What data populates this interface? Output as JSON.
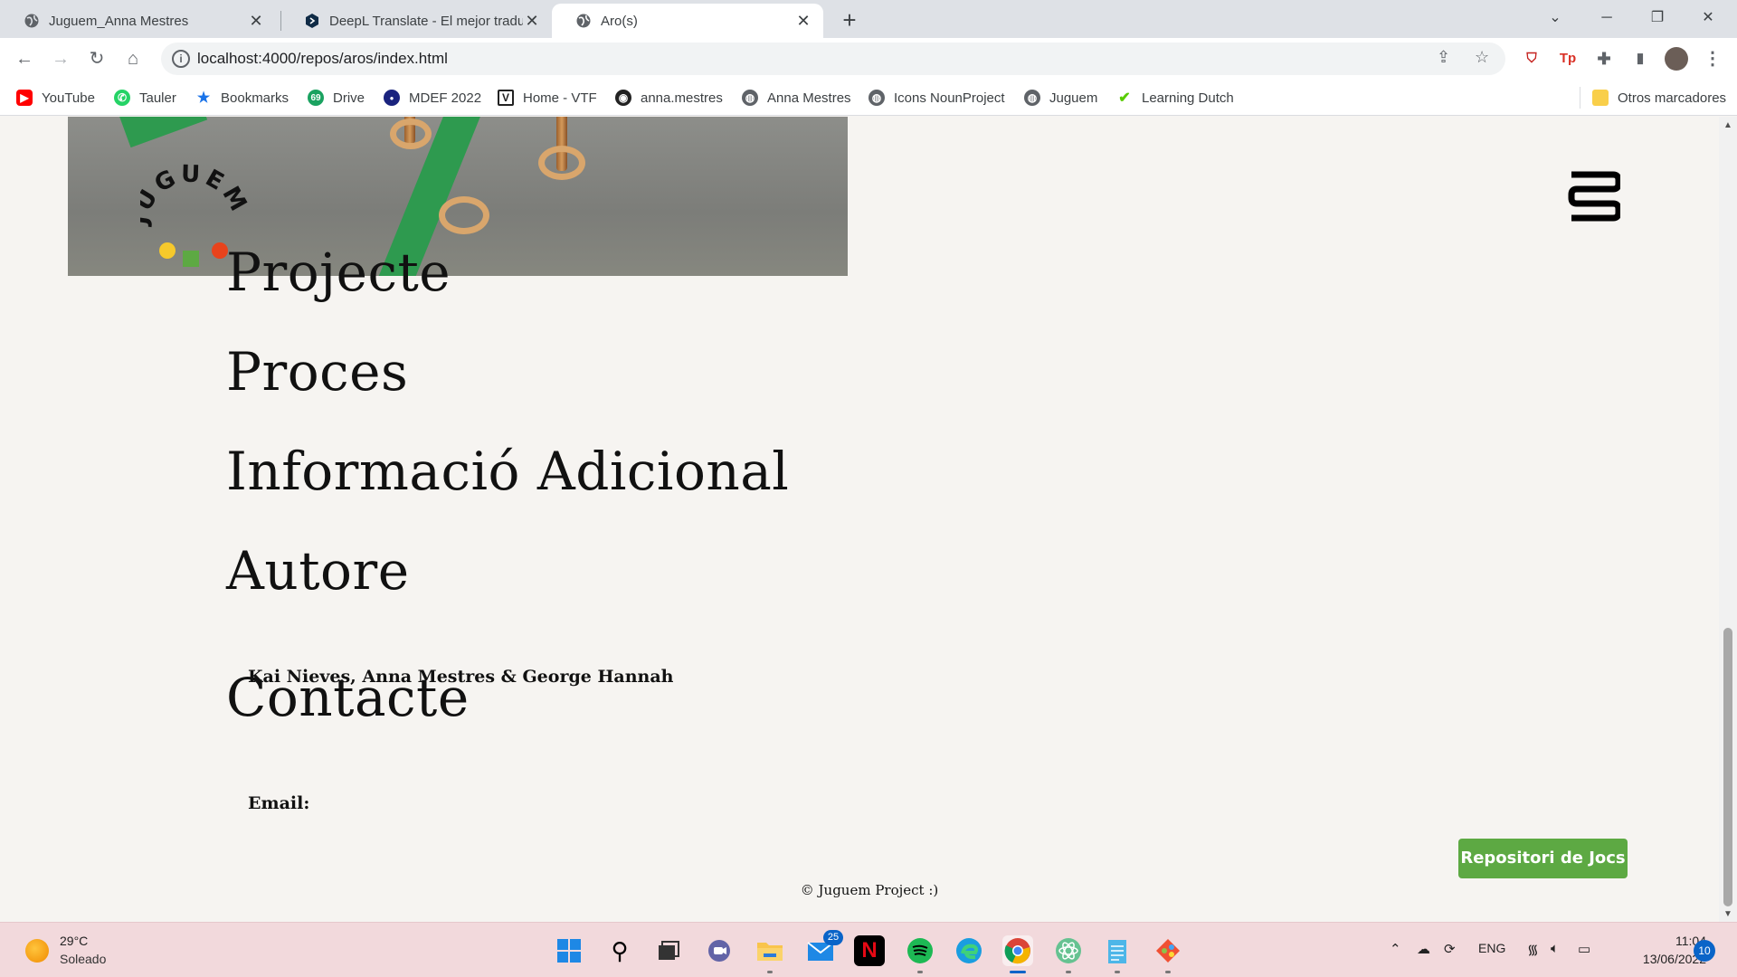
{
  "browser": {
    "tabs": [
      {
        "title": "Juguem_Anna Mestres",
        "icon": "globe-icon"
      },
      {
        "title": "DeepL Translate - El mejor traduc",
        "icon": "deepl-icon"
      },
      {
        "title": "Aro(s)",
        "icon": "globe-icon",
        "active": true
      }
    ],
    "url": "localhost:4000/repos/aros/index.html",
    "bookmarks": [
      {
        "label": "YouTube",
        "icon": "youtube-icon",
        "color": "#ff0000"
      },
      {
        "label": "Tauler",
        "icon": "whatsapp-icon",
        "color": "#25d366"
      },
      {
        "label": "Bookmarks",
        "icon": "star-icon",
        "color": "#1a73e8"
      },
      {
        "label": "Drive",
        "icon": "drive-icon",
        "color": "#1aa260"
      },
      {
        "label": "MDEF 2022",
        "icon": "mdef-icon",
        "color": "#1a237e"
      },
      {
        "label": "Home - VTF",
        "icon": "vtf-icon",
        "color": "#222222"
      },
      {
        "label": "anna.mestres",
        "icon": "github-icon",
        "color": "#222222"
      },
      {
        "label": "Anna Mestres",
        "icon": "globe-icon",
        "color": "#5f6368"
      },
      {
        "label": "Icons NounProject",
        "icon": "globe-icon",
        "color": "#5f6368"
      },
      {
        "label": "Juguem",
        "icon": "globe-icon",
        "color": "#5f6368"
      },
      {
        "label": "Learning Dutch",
        "icon": "duolingo-icon",
        "color": "#58cc02"
      }
    ],
    "other_bookmarks": "Otros marcadores"
  },
  "page": {
    "sections": [
      {
        "title": "Projecte"
      },
      {
        "title": "Proces"
      },
      {
        "title": "Informació Adicional"
      },
      {
        "title": "Autore",
        "text": "Kai Nieves, Anna Mestres & George Hannah"
      },
      {
        "title": "Contacte",
        "text": "Email:"
      }
    ],
    "logo_letters": "JUGUEM",
    "repo_button": "Repositori de Jocs",
    "footer": "© Juguem Project :)",
    "accent_green": "#5da943"
  },
  "taskbar": {
    "weather_temp": "29°C",
    "weather_cond": "Soleado",
    "mail_badge": "25",
    "language": "ENG",
    "time": "11:04",
    "date": "13/06/2022",
    "notifications": "10"
  }
}
